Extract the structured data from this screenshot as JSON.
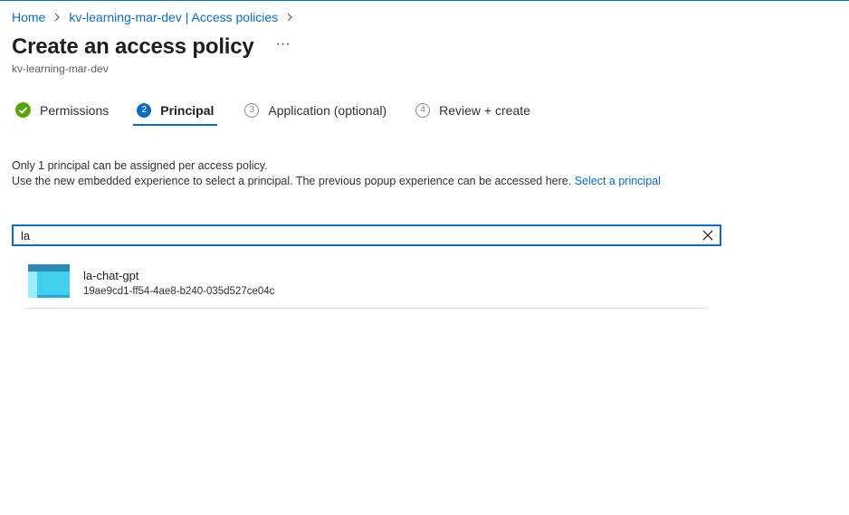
{
  "breadcrumb": {
    "items": [
      {
        "label": "Home"
      },
      {
        "label": "kv-learning-mar-dev | Access policies"
      }
    ]
  },
  "page": {
    "title": "Create an access policy",
    "more_label": "···",
    "subtitle": "kv-learning-mar-dev"
  },
  "tabs": [
    {
      "number": "✓",
      "label": "Permissions",
      "state": "completed"
    },
    {
      "number": "2",
      "label": "Principal",
      "state": "active"
    },
    {
      "number": "3",
      "label": "Application (optional)",
      "state": "pending"
    },
    {
      "number": "4",
      "label": "Review + create",
      "state": "pending"
    }
  ],
  "info": {
    "line1": "Only 1 principal can be assigned per access policy.",
    "line2": "Use the new embedded experience to select a principal. The previous popup experience can be accessed here.",
    "link": "Select a principal"
  },
  "search": {
    "value": "la",
    "placeholder": ""
  },
  "results": [
    {
      "name": "la-chat-gpt",
      "id": "19ae9cd1-ff54-4ae8-b240-035d527ce04c",
      "icon": "app-registration-icon"
    }
  ],
  "colors": {
    "accent": "#0f6cbd",
    "success": "#57a300",
    "text": "#323130"
  }
}
